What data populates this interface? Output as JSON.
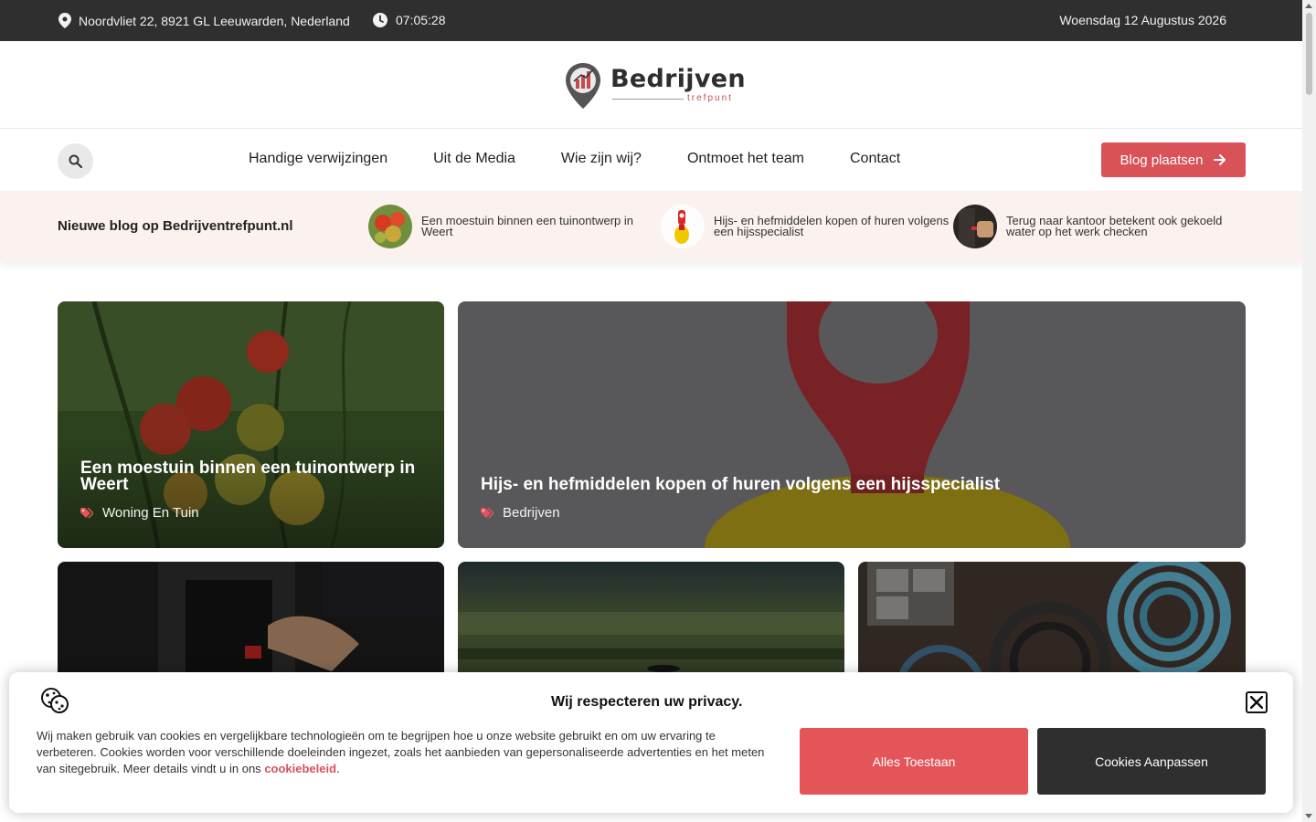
{
  "topbar": {
    "address": "Noordvliet 22, 8921 GL Leeuwarden, Nederland",
    "time": "07:05:28",
    "date": "Woensdag 12 Augustus 2026"
  },
  "logo": {
    "word": "Bedrijven",
    "sub": "trefpunt"
  },
  "nav": {
    "items": [
      "Handige verwijzingen",
      "Uit de Media",
      "Wie zijn wij?",
      "Ontmoet het team",
      "Contact"
    ],
    "cta": "Blog plaatsen"
  },
  "ticker": {
    "label": "Nieuwe blog op Bedrijventrefpunt.nl",
    "items": [
      "Een moestuin binnen een tuinontwerp in Weert",
      "Hijs- en hefmiddelen kopen of huren volgens een hijsspecialist",
      "Terug naar kantoor betekent ook gekoeld water op het werk checken"
    ]
  },
  "cards": [
    {
      "title": "Een moestuin binnen een tuinontwerp in Weert",
      "category": "Woning En Tuin"
    },
    {
      "title": "Hijs- en hefmiddelen kopen of huren volgens een hijsspecialist",
      "category": "Bedrijven"
    }
  ],
  "cookie": {
    "title": "Wij respecteren uw privacy.",
    "text": "Wij maken gebruik van cookies en vergelijkbare technologieën om te begrijpen hoe u onze website gebruikt en om uw ervaring te verbeteren. Cookies worden voor verschillende doeleinden ingezet, zoals het aanbieden van gepersonaliseerde advertenties en het meten van sitegebruik. Meer details vindt u in ons",
    "link": "cookiebeleid",
    "accept": "Alles Toestaan",
    "customize": "Cookies Aanpassen"
  },
  "colors": {
    "accent": "#d85258",
    "dark": "#2f2f2f",
    "ticker_bg": "#fbf1ef"
  }
}
